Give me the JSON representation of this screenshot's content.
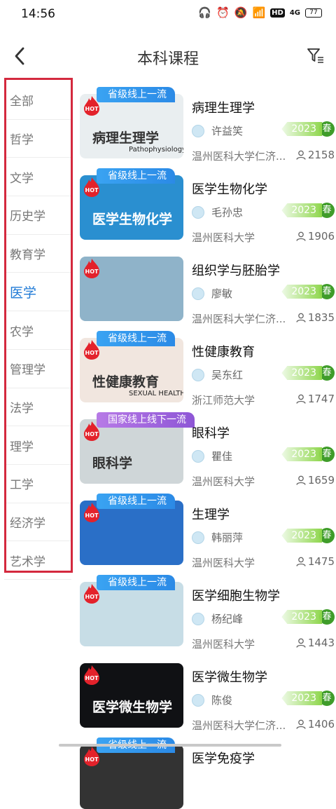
{
  "status_bar": {
    "time": "14:56",
    "network": "4G",
    "battery": "77"
  },
  "header": {
    "title": "本科课程"
  },
  "categories": [
    {
      "label": "全部"
    },
    {
      "label": "哲学"
    },
    {
      "label": "文学"
    },
    {
      "label": "历史学"
    },
    {
      "label": "教育学"
    },
    {
      "label": "医学"
    },
    {
      "label": "农学"
    },
    {
      "label": "管理学"
    },
    {
      "label": "法学"
    },
    {
      "label": "理学"
    },
    {
      "label": "工学"
    },
    {
      "label": "经济学"
    },
    {
      "label": "艺术学"
    }
  ],
  "selected_category": "医学",
  "hot_label": "HOT",
  "courses": [
    {
      "title": "病理生理学",
      "teacher": "许益笑",
      "school": "温州医科大学仁济...",
      "count": "2158",
      "year": "2023",
      "season": "春",
      "badge": "省级线上一流",
      "badge_color": "blue",
      "thumb_text": "病理生理学",
      "thumb_sub": "Pathophysiology",
      "thumb_bg": "#e9eef0"
    },
    {
      "title": "医学生物化学",
      "teacher": "毛孙忠",
      "school": "温州医科大学",
      "count": "1906",
      "year": "2023",
      "season": "春",
      "badge": "省级线上一流",
      "badge_color": "blue",
      "thumb_text": "医学生物化学",
      "thumb_sub": "",
      "thumb_bg": "#2a8fd0"
    },
    {
      "title": "组织学与胚胎学",
      "teacher": "廖敏",
      "school": "温州医科大学仁济...",
      "count": "1835",
      "year": "2023",
      "season": "春",
      "badge": "",
      "badge_color": "",
      "thumb_text": "",
      "thumb_sub": "",
      "thumb_bg": "#8fb3c9"
    },
    {
      "title": "性健康教育",
      "teacher": "吴东红",
      "school": "浙江师范大学",
      "count": "1747",
      "year": "2023",
      "season": "春",
      "badge": "省级线上一流",
      "badge_color": "blue",
      "thumb_text": "性健康教育",
      "thumb_sub": "SEXUAL HEALTH EDUCATION",
      "thumb_bg": "#f1e6df"
    },
    {
      "title": "眼科学",
      "teacher": "瞿佳",
      "school": "温州医科大学",
      "count": "1659",
      "year": "2023",
      "season": "春",
      "badge": "国家线上线下一流",
      "badge_color": "purple",
      "thumb_text": "眼科学",
      "thumb_sub": "",
      "thumb_bg": "#cfd6d8"
    },
    {
      "title": "生理学",
      "teacher": "韩丽萍",
      "school": "温州医科大学",
      "count": "1475",
      "year": "2023",
      "season": "春",
      "badge": "省级线上一流",
      "badge_color": "blue",
      "thumb_text": "",
      "thumb_sub": "",
      "thumb_bg": "#2a6fc7"
    },
    {
      "title": "医学细胞生物学",
      "teacher": "杨纪峰",
      "school": "温州医科大学",
      "count": "1443",
      "year": "2023",
      "season": "春",
      "badge": "省级线上一流",
      "badge_color": "blue",
      "thumb_text": "",
      "thumb_sub": "",
      "thumb_bg": "#c7dde6"
    },
    {
      "title": "医学微生物学",
      "teacher": "陈俊",
      "school": "温州医科大学仁济...",
      "count": "1406",
      "year": "2023",
      "season": "春",
      "badge": "",
      "badge_color": "",
      "thumb_text": "医学微生物学",
      "thumb_sub": "",
      "thumb_bg": "#101114"
    },
    {
      "title": "医学免疫学",
      "teacher": "",
      "school": "",
      "count": "",
      "year": "",
      "season": "",
      "badge": "省级线上一流",
      "badge_color": "blue",
      "thumb_text": "",
      "thumb_sub": "",
      "thumb_bg": "#333"
    }
  ]
}
